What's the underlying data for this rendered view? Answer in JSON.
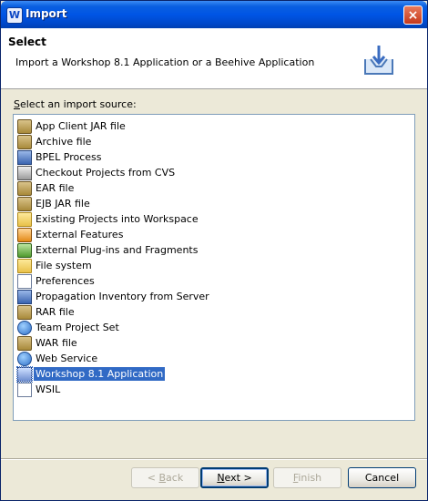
{
  "window": {
    "title": "Import",
    "app_icon_letter": "W",
    "close_glyph": "×"
  },
  "header": {
    "title": "Select",
    "description": "Import a Workshop 8.1 Application or a Beehive Application",
    "banner_icon": "import-wizard-icon"
  },
  "source": {
    "label_prefix": "S",
    "label_rest": "elect an import source:"
  },
  "tree": {
    "items": [
      {
        "label": "App Client JAR file",
        "icon": "jar-icon"
      },
      {
        "label": "Archive file",
        "icon": "archive-icon"
      },
      {
        "label": "BPEL Process",
        "icon": "bpel-icon"
      },
      {
        "label": "Checkout Projects from CVS",
        "icon": "cvs-icon"
      },
      {
        "label": "EAR file",
        "icon": "ear-icon"
      },
      {
        "label": "EJB JAR file",
        "icon": "ejb-icon"
      },
      {
        "label": "Existing Projects into Workspace",
        "icon": "projects-icon"
      },
      {
        "label": "External Features",
        "icon": "features-icon"
      },
      {
        "label": "External Plug-ins and Fragments",
        "icon": "plugins-icon"
      },
      {
        "label": "File system",
        "icon": "folder-icon"
      },
      {
        "label": "Preferences",
        "icon": "preferences-icon"
      },
      {
        "label": "Propagation Inventory from Server",
        "icon": "propagation-icon"
      },
      {
        "label": "RAR file",
        "icon": "rar-icon"
      },
      {
        "label": "Team Project Set",
        "icon": "team-icon"
      },
      {
        "label": "WAR file",
        "icon": "war-icon"
      },
      {
        "label": "Web Service",
        "icon": "web-service-icon"
      },
      {
        "label": "Workshop 8.1 Application",
        "icon": "workshop-icon"
      },
      {
        "label": "WSIL",
        "icon": "wsil-icon"
      }
    ],
    "selected_index": 16
  },
  "buttons": {
    "back": {
      "prefix": "< ",
      "mnemonic": "B",
      "rest": "ack"
    },
    "next": {
      "mnemonic": "N",
      "rest": "ext >"
    },
    "finish": {
      "mnemonic": "F",
      "rest": "inish"
    },
    "cancel": {
      "label": "Cancel"
    }
  }
}
